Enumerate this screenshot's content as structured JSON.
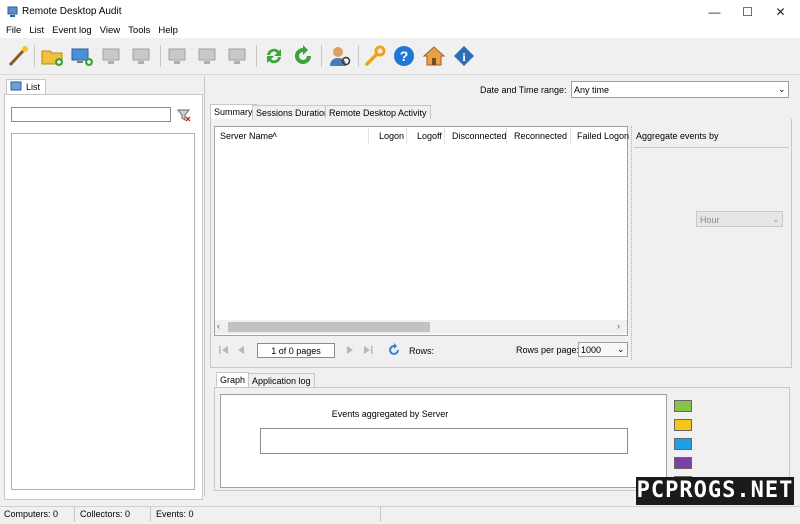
{
  "window": {
    "title": "Remote Desktop Audit"
  },
  "menu": [
    "File",
    "List",
    "Event log",
    "View",
    "Tools",
    "Help"
  ],
  "toolbar": {
    "icons": [
      "wand-icon",
      "add-folder-icon",
      "add-computer-icon",
      "computer-disabled-icon",
      "computer-disabled-icon",
      "computer-disabled-icon",
      "computer-disabled-icon",
      "computer-disabled-icon",
      "sync-icon",
      "refresh-icon",
      "user-search-icon",
      "wrench-icon",
      "help-icon",
      "home-icon",
      "info-icon"
    ]
  },
  "left": {
    "tab_label": "List",
    "search_value": ""
  },
  "filters": {
    "range_label": "Date and Time range:",
    "range_value": "Any time"
  },
  "tabs": [
    "Summary",
    "Sessions Duration",
    "Remote Desktop Activity"
  ],
  "grid": {
    "columns": [
      "Server Name",
      "Logon",
      "Logoff",
      "Disconnected",
      "Reconnected",
      "Failed Logon"
    ]
  },
  "aggregate": {
    "label": "Aggregate events by",
    "value": "Hour"
  },
  "pager": {
    "page_text": "1 of 0 pages",
    "rows_label": "Rows:",
    "rpp_label": "Rows per page:",
    "rpp_value": "1000"
  },
  "bottom_tabs": [
    "Graph",
    "Application log"
  ],
  "graph": {
    "title": "Events aggregated by Server",
    "legend_colors": [
      "#8bc34a",
      "#f5c518",
      "#1e9fe6",
      "#7b3fa6",
      "#8b1a1a"
    ]
  },
  "status": {
    "computers": "Computers: 0",
    "collectors": "Collectors: 0",
    "events": "Events: 0"
  },
  "watermark": "PCPROGS.NET"
}
